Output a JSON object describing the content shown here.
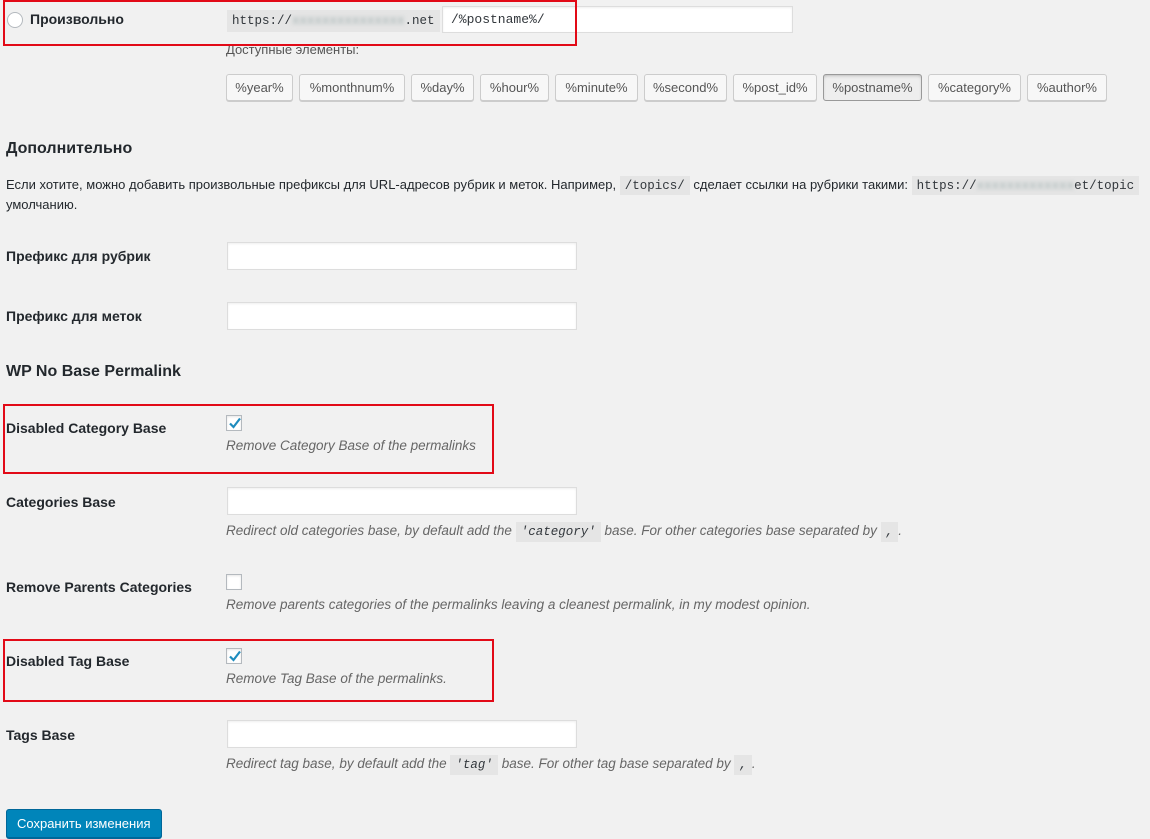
{
  "custom_structure": {
    "radio_label": "Произвольно",
    "url_prefix_start": "https://",
    "url_prefix_end": ".net",
    "value": "/%postname%/",
    "available_label": "Доступные элементы:",
    "tags": [
      "%year%",
      "%monthnum%",
      "%day%",
      "%hour%",
      "%minute%",
      "%second%",
      "%post_id%",
      "%postname%",
      "%category%",
      "%author%"
    ],
    "active_tag": "%postname%"
  },
  "optional": {
    "heading": "Дополнительно",
    "desc_part1": "Если хотите, можно добавить произвольные префиксы для URL-адресов рубрик и меток. Например,",
    "desc_code": "/topics/",
    "desc_part2": "сделает ссылки на рубрики такими:",
    "desc_url_start": "https://",
    "desc_url_end": "et/topic",
    "desc_line2": "умолчанию.",
    "category_prefix_label": "Префикс для рубрик",
    "category_prefix_value": "",
    "tag_prefix_label": "Префикс для меток",
    "tag_prefix_value": ""
  },
  "plugin": {
    "heading": "WP No Base Permalink",
    "disabled_category_base": {
      "label": "Disabled Category Base",
      "checked": true,
      "description": "Remove Category Base of the permalinks"
    },
    "categories_base": {
      "label": "Categories Base",
      "value": "",
      "desc_a": "Redirect old categories base, by default add the",
      "desc_code": "'category'",
      "desc_b": "base. For other categories base separated by",
      "desc_sep": ",",
      "desc_end": "."
    },
    "remove_parents": {
      "label": "Remove Parents Categories",
      "checked": false,
      "description": "Remove parents categories of the permalinks leaving a cleanest permalink, in my modest opinion."
    },
    "disabled_tag_base": {
      "label": "Disabled Tag Base",
      "checked": true,
      "description": "Remove Tag Base of the permalinks."
    },
    "tags_base": {
      "label": "Tags Base",
      "value": "",
      "desc_a": "Redirect tag base, by default add the",
      "desc_code": "'tag'",
      "desc_b": "base. For other tag base separated by",
      "desc_sep": ",",
      "desc_end": "."
    }
  },
  "save_button": "Сохранить изменения",
  "colors": {
    "highlight_box": "#e20a17",
    "primary_button": "#0085ba",
    "checkmark": "#1e8cbe"
  }
}
